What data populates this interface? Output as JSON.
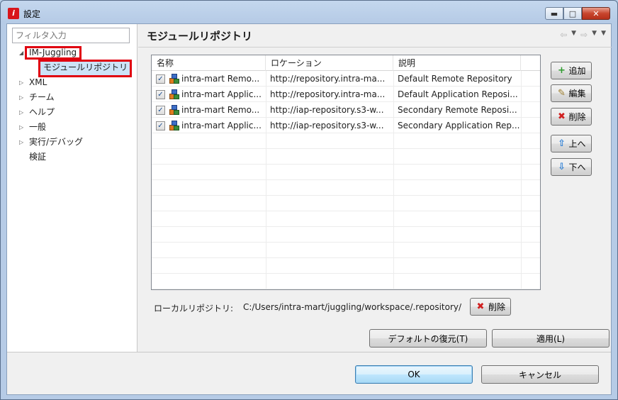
{
  "window": {
    "title": "設定",
    "app_icon_glyph": "i",
    "minimize_glyph": "▬",
    "maximize_glyph": "□",
    "close_glyph": "✕"
  },
  "filter": {
    "placeholder": "フィルタ入力",
    "value": ""
  },
  "tree": {
    "root": {
      "label": "IM-Juggling",
      "arrow": "◢",
      "expanded": true
    },
    "selected_child": {
      "label": "モジュールリポジトリ"
    },
    "items": [
      {
        "label": "XML",
        "arrow": "▷"
      },
      {
        "label": "チーム",
        "arrow": "▷"
      },
      {
        "label": "ヘルプ",
        "arrow": "▷"
      },
      {
        "label": "一般",
        "arrow": "▷"
      },
      {
        "label": "実行/デバッグ",
        "arrow": "▷"
      },
      {
        "label": "検証",
        "arrow": ""
      }
    ]
  },
  "page": {
    "title": "モジュールリポジトリ",
    "nav": {
      "back": "⇦",
      "forward": "⇨",
      "dropdown": "▼",
      "menu": "▼"
    }
  },
  "table": {
    "columns": [
      "名称",
      "ロケーション",
      "説明"
    ],
    "rows": [
      {
        "checked": true,
        "name": "intra-mart Remo...",
        "location": "http://repository.intra-ma...",
        "description": "Default Remote Repository"
      },
      {
        "checked": true,
        "name": "intra-mart Applic...",
        "location": "http://repository.intra-ma...",
        "description": "Default Application Reposi..."
      },
      {
        "checked": true,
        "name": "intra-mart Remo...",
        "location": "http://iap-repository.s3-w...",
        "description": "Secondary Remote Reposi..."
      },
      {
        "checked": true,
        "name": "intra-mart Applic...",
        "location": "http://iap-repository.s3-w...",
        "description": "Secondary Application Rep..."
      }
    ]
  },
  "side_buttons": {
    "add": "追加",
    "edit": "編集",
    "delete": "削除",
    "up": "上へ",
    "down": "下へ"
  },
  "icons": {
    "add": "plus-icon",
    "edit": "pencil-icon",
    "delete": "x-icon",
    "up": "arrow-up-icon",
    "down": "arrow-down-icon"
  },
  "glyphs": {
    "plus": "+",
    "pencil": "✎",
    "x": "✖",
    "up": "⇧",
    "down": "⇩",
    "check": "✓"
  },
  "local_repo": {
    "label": "ローカルリポジトリ:",
    "path": "C:/Users/intra-mart/juggling/workspace/.repository/",
    "delete": "削除"
  },
  "buttons": {
    "restore_defaults": "デフォルトの復元(T)",
    "apply": "適用(L)",
    "ok": "OK",
    "cancel": "キャンセル"
  },
  "colors": {
    "highlight_border": "#e00010",
    "selection": "#cde3f7",
    "default_button_border": "#3c7fb1"
  }
}
